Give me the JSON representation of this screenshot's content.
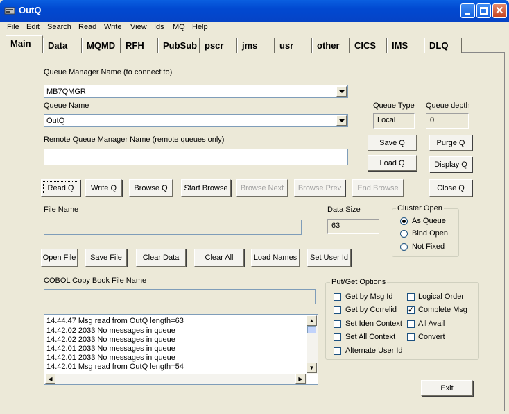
{
  "window": {
    "title": "OutQ"
  },
  "menu": [
    "File",
    "Edit",
    "Search",
    "Read",
    "Write",
    "View",
    "Ids",
    "MQ",
    "Help"
  ],
  "tabs": [
    "Main",
    "Data",
    "MQMD",
    "RFH",
    "PubSub",
    "pscr",
    "jms",
    "usr",
    "other",
    "CICS",
    "IMS",
    "DLQ"
  ],
  "form": {
    "qm_label": "Queue Manager Name (to connect to)",
    "qm_value": "MB7QMGR",
    "queue_label": "Queue Name",
    "queue_value": "OutQ",
    "remote_label": "Remote Queue Manager Name (remote queues only)",
    "remote_value": "",
    "qtype_label": "Queue Type",
    "qtype_value": "Local",
    "qdepth_label": "Queue depth",
    "qdepth_value": "0",
    "file_label": "File Name",
    "datasize_label": "Data Size",
    "datasize_value": "63",
    "cobol_label": "COBOL Copy Book File Name"
  },
  "buttons": {
    "save_q": "Save Q",
    "purge_q": "Purge Q",
    "load_q": "Load Q",
    "display_q": "Display Q",
    "read_q": "Read Q",
    "write_q": "Write Q",
    "browse_q": "Browse Q",
    "start_browse": "Start Browse",
    "browse_next": "Browse Next",
    "browse_prev": "Browse Prev",
    "end_browse": "End Browse",
    "close_q": "Close Q",
    "open_file": "Open File",
    "save_file": "Save File",
    "clear_data": "Clear Data",
    "clear_all": "Clear All",
    "load_names": "Load Names",
    "set_user_id": "Set User Id",
    "exit": "Exit"
  },
  "cluster": {
    "title": "Cluster Open",
    "options": [
      "As Queue",
      "Bind Open",
      "Not Fixed"
    ],
    "selected": "As Queue"
  },
  "putget": {
    "title": "Put/Get Options",
    "options": [
      {
        "label": "Get by Msg Id",
        "checked": false
      },
      {
        "label": "Logical Order",
        "checked": false
      },
      {
        "label": "Get by Correlid",
        "checked": false
      },
      {
        "label": "Complete Msg",
        "checked": true
      },
      {
        "label": "Set Iden Context",
        "checked": false
      },
      {
        "label": "All Avail",
        "checked": false
      },
      {
        "label": "Set All Context",
        "checked": false
      },
      {
        "label": "Convert",
        "checked": false
      },
      {
        "label": "Alternate User Id",
        "checked": false
      }
    ]
  },
  "log": [
    "14.44.47 Msg read from OutQ length=63",
    "14.42.02 2033 No messages in queue",
    "14.42.02 2033 No messages in queue",
    "14.42.01 2033 No messages in queue",
    "14.42.01 2033 No messages in queue",
    "14.42.01 Msg read from OutQ length=54"
  ],
  "colors": {
    "titlebar": "#0149d1",
    "face": "#ece9d8"
  }
}
